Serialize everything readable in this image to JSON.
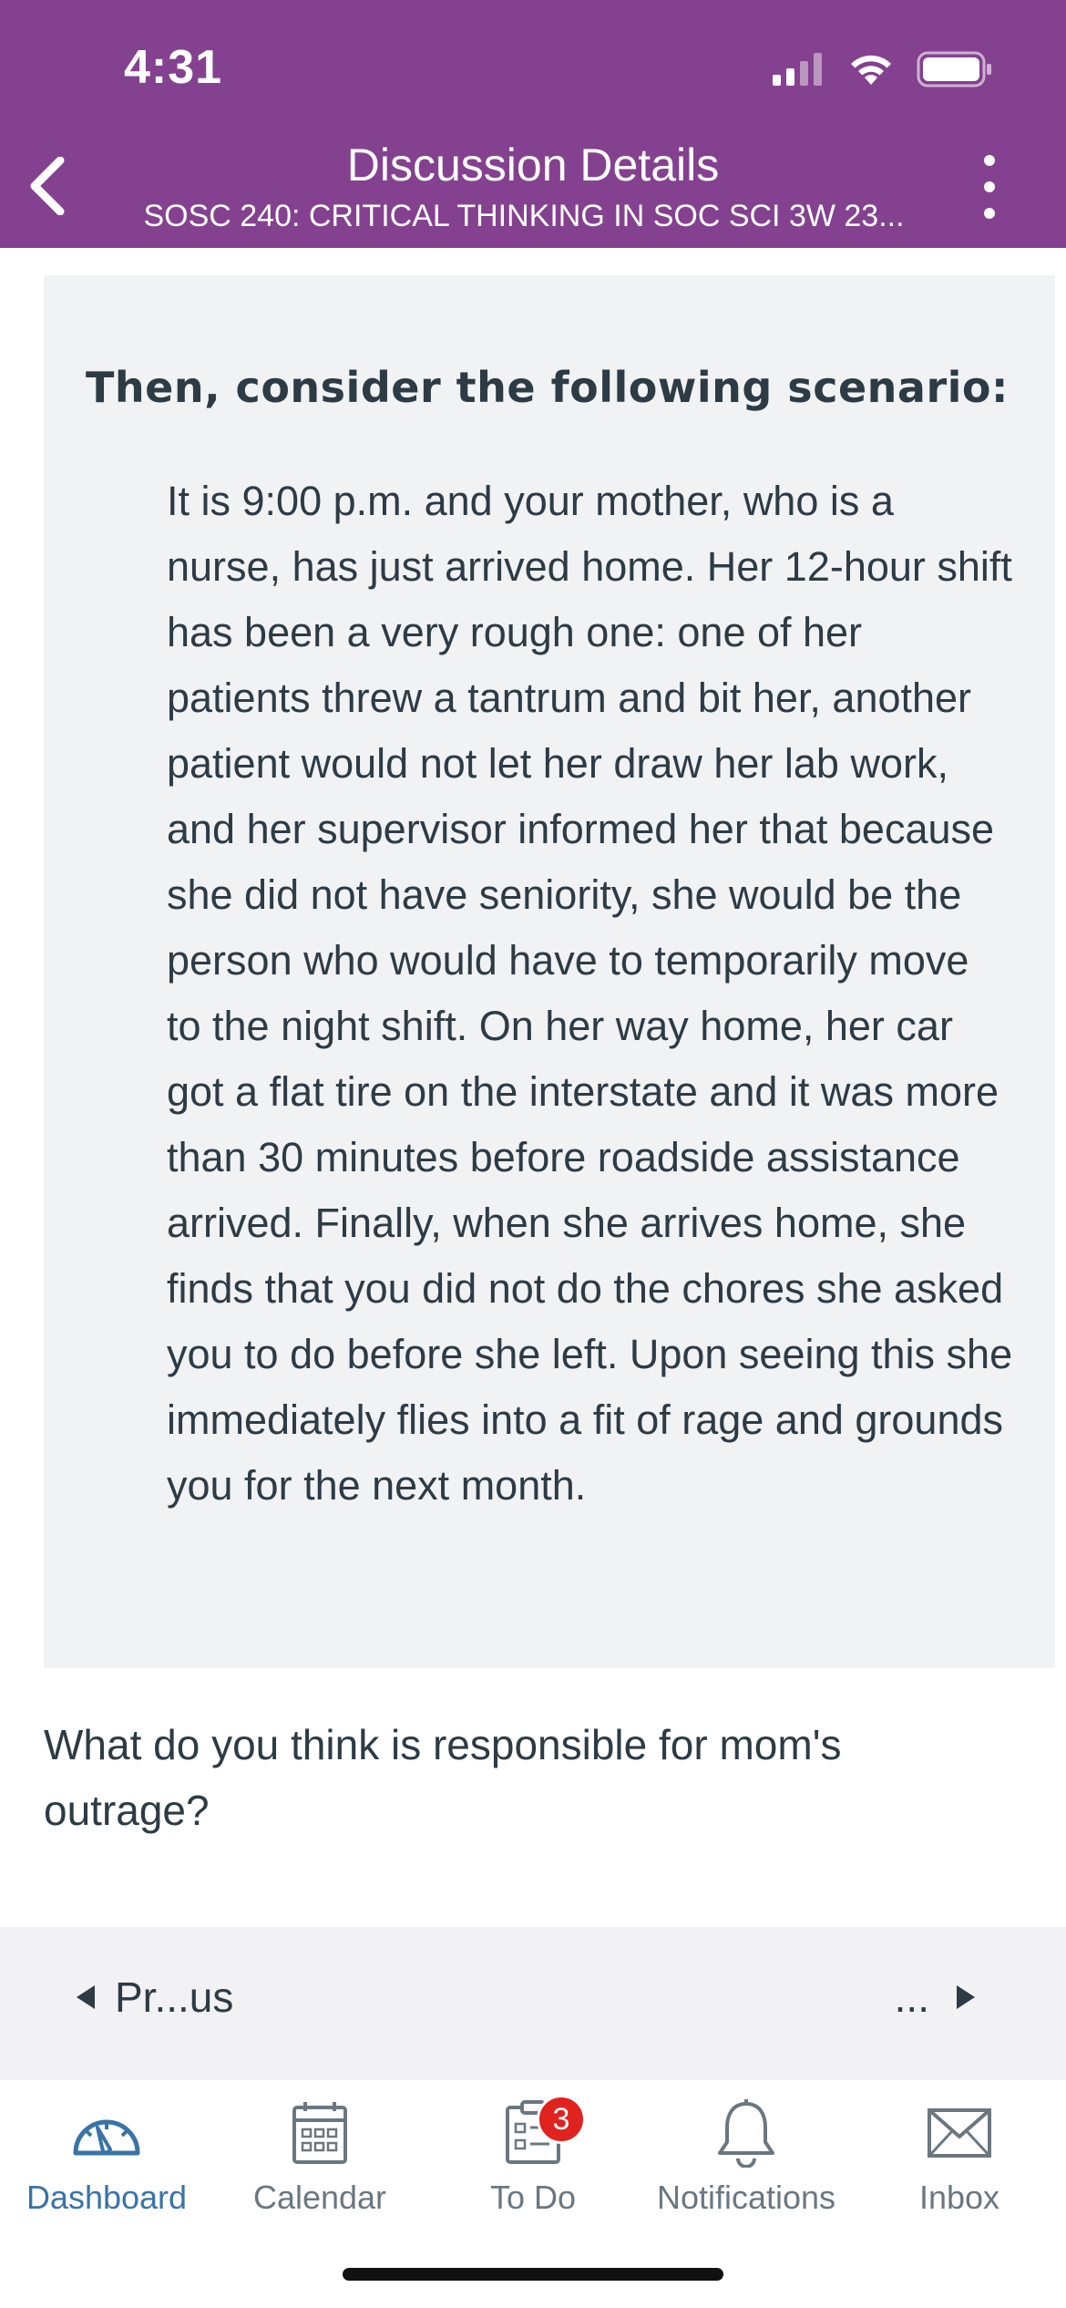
{
  "status_bar": {
    "time": "4:31"
  },
  "header": {
    "title": "Discussion Details",
    "subtitle": "SOSC 240: CRITICAL THINKING IN SOC SCI 3W 23...",
    "background_color": "#84418f"
  },
  "content": {
    "heading": "Then, consider the following scenario:",
    "scenario": "It is 9:00 p.m. and your mother, who is a nurse, has just arrived home. Her 12-hour shift has been a very rough one: one of her patients threw a tantrum and bit her, another patient would not let her draw her lab work, and her supervisor informed her that because she did not have seniority, she would be the person who would have to temporarily move to the night shift. On her way home, her car got a flat tire on the interstate and it was more than 30 minutes before roadside assistance arrived. Finally, when she arrives home, she finds that you did not do the chores she asked you to do before she left. Upon seeing this she immediately flies into a fit of rage and grounds you for the next month.",
    "question": "What do you think is responsible for mom's outrage?"
  },
  "pager": {
    "previous_label": "Pr...us",
    "next_label": "..."
  },
  "tabbar": {
    "active_color": "#3a73a8",
    "items": [
      {
        "label": "Dashboard",
        "icon": "dashboard-icon"
      },
      {
        "label": "Calendar",
        "icon": "calendar-icon"
      },
      {
        "label": "To Do",
        "icon": "todo-icon",
        "badge": "3"
      },
      {
        "label": "Notifications",
        "icon": "bell-icon"
      },
      {
        "label": "Inbox",
        "icon": "envelope-icon"
      }
    ]
  }
}
